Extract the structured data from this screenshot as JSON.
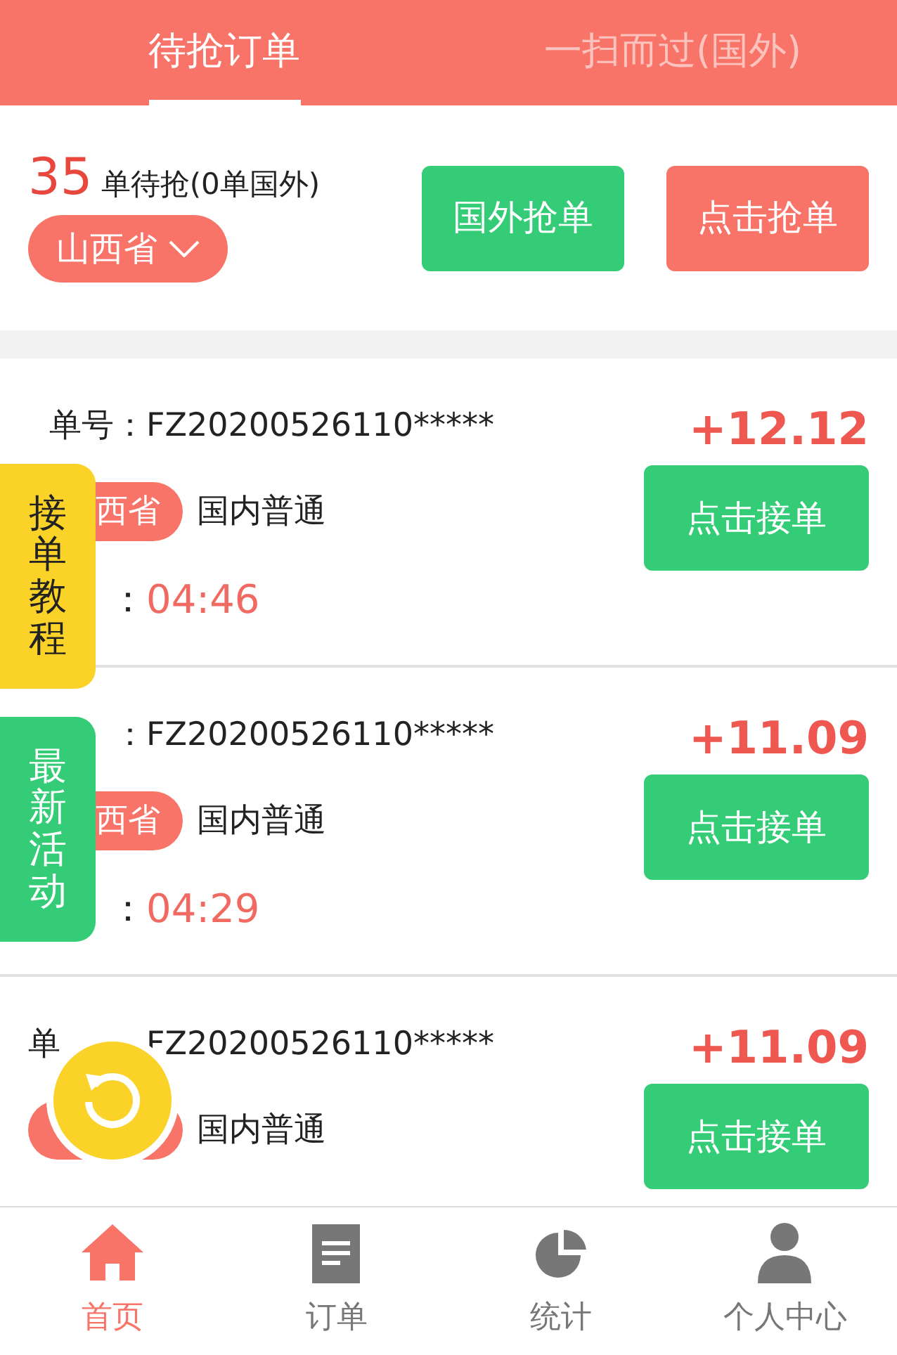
{
  "tabs": [
    {
      "label": "待抢订单",
      "selected": true
    },
    {
      "label": "一扫而过(国外)",
      "selected": false
    }
  ],
  "summary": {
    "count": "35",
    "count_text": "单待抢(0单国外)",
    "province": "山西省",
    "buttons": [
      {
        "label": "国外抢单",
        "kind": "green"
      },
      {
        "label": "点击抢单",
        "kind": "red"
      }
    ]
  },
  "orders": [
    {
      "kind": "side_tab",
      "number_label": "单号：",
      "number": "FZ20200526110*****",
      "price": "+12.12",
      "tag": "西省",
      "type": "国内普通",
      "time_label": "：",
      "time": "04:46",
      "button": "点击接单"
    },
    {
      "kind": "side_tab",
      "number_label": "：",
      "number": "FZ20200526110*****",
      "price": "+11.09",
      "tag": "西省",
      "type": "国内普通",
      "time_label": "：",
      "time": "04:29",
      "button": "点击接单"
    },
    {
      "kind": "refresh_button",
      "number_label": "单",
      "number": "FZ20200526110*****",
      "price": "+11.09",
      "type": "国内普通",
      "button": "点击接单"
    }
  ],
  "side_tabs": [
    {
      "label": "接单教程",
      "kind": "yellow"
    },
    {
      "label": "最新活动",
      "kind": "green"
    }
  ],
  "nav": [
    {
      "label": "首页",
      "kind": "home",
      "selected": true
    },
    {
      "label": "订单",
      "kind": "doc",
      "selected": false
    },
    {
      "label": "统计",
      "kind": "pie",
      "selected": false
    },
    {
      "label": "个人中心",
      "kind": "user",
      "selected": false
    }
  ]
}
